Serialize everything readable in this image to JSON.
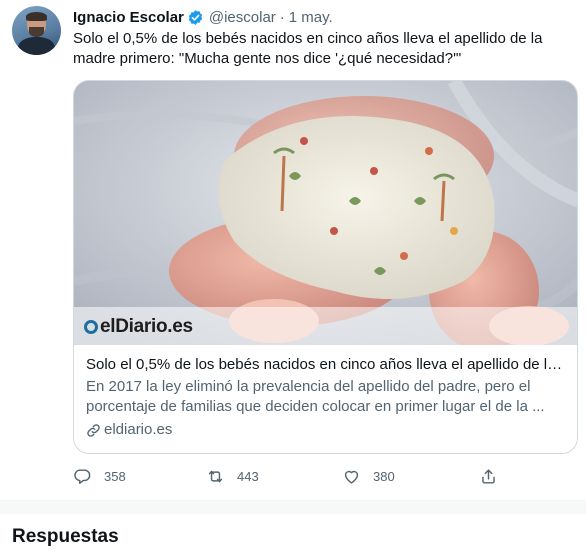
{
  "tweet": {
    "author_name": "Ignacio Escolar",
    "handle": "@iescolar",
    "separator": "·",
    "date": "1 may.",
    "text": "Solo el 0,5% de los bebés nacidos en cinco años lleva el apellido de la madre primero: \"Mucha gente nos dice '¿qué necesidad?'\"",
    "verified": true
  },
  "card": {
    "logo_text": "elDiario.es",
    "title": "Solo el 0,5% de los bebés nacidos en cinco años lleva el apellido de la ...",
    "description": "En 2017 la ley eliminó la prevalencia del apellido del padre, pero el porcentaje de familias que deciden colocar en primer lugar el de la ...",
    "domain": "eldiario.es"
  },
  "actions": {
    "reply_count": "358",
    "retweet_count": "443",
    "like_count": "380"
  },
  "section": {
    "replies_heading": "Respuestas"
  },
  "colors": {
    "verified": "#1d9bf0",
    "secondary_text": "#536471",
    "primary_text": "#0f1419",
    "border": "#cfd9de"
  }
}
